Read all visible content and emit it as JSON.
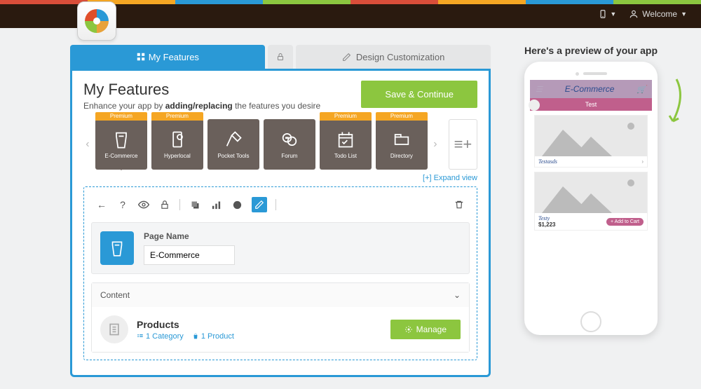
{
  "header": {
    "welcome_label": "Welcome"
  },
  "tabs": {
    "features": "My Features",
    "design": "Design Customization"
  },
  "panel": {
    "title": "My Features",
    "subtitle_pre": "Enhance your app by ",
    "subtitle_bold": "adding/replacing",
    "subtitle_post": " the features you desire",
    "save_label": "Save & Continue",
    "expand_label": "[+] Expand view"
  },
  "features": [
    {
      "label": "E-Commerce",
      "premium": "Premium",
      "active": true
    },
    {
      "label": "Hyperlocal",
      "premium": "Premium",
      "active": false
    },
    {
      "label": "Pocket Tools",
      "premium": "",
      "active": false
    },
    {
      "label": "Forum",
      "premium": "",
      "active": false
    },
    {
      "label": "Todo List",
      "premium": "Premium",
      "active": false
    },
    {
      "label": "Directory",
      "premium": "Premium",
      "active": false
    }
  ],
  "editor": {
    "page_name_label": "Page Name",
    "page_name_value": "E-Commerce",
    "content_label": "Content",
    "products_title": "Products",
    "category_count": "1 Category",
    "product_count": "1 Product",
    "manage_label": "Manage"
  },
  "preview": {
    "title": "Here's a preview of your app",
    "app_title": "E-Commerce",
    "tab_label": "Test",
    "item1_name": "Testasds",
    "item2_name": "Testy",
    "item2_price": "$1,223",
    "add_to_cart": "+ Add to Cart"
  },
  "colors": {
    "primary": "#2a99d6",
    "success": "#8cc63f",
    "premium": "#f5a623",
    "card": "#6a605b"
  }
}
